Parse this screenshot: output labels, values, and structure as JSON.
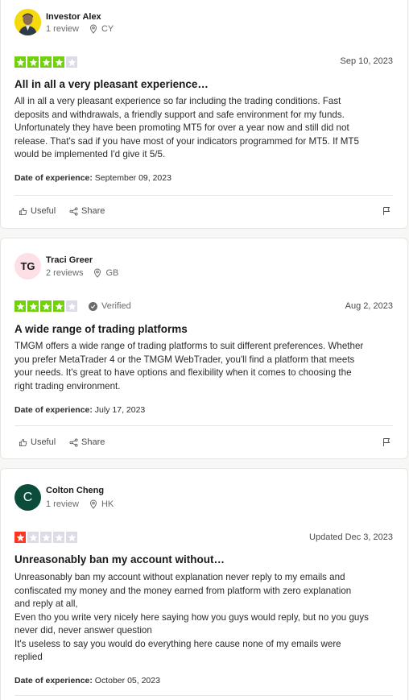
{
  "reviews": [
    {
      "name": "Investor Alex",
      "review_count": "1 review",
      "country": "CY",
      "rating": 4,
      "star_color": "#73cf11",
      "verified": "",
      "date": "Sep 10, 2023",
      "title": "All in all a very pleasant experience…",
      "body": [
        "All in all a very pleasant experience so far including the trading conditions. Fast",
        "deposits and withdrawals, a friendly support and safe environment for my funds.",
        "Unfortunately they have been promoting MT5 for over a year now and still did not",
        "release. That's sad if you have most of your indicators programmed for MT5. If MT5",
        "would be implemented I'd give it 5/5."
      ],
      "exp_label": "Date of experience:",
      "exp_date": "September 09, 2023",
      "useful": "Useful",
      "share": "Share"
    },
    {
      "name": "Traci Greer",
      "initials": "TG",
      "review_count": "2 reviews",
      "country": "GB",
      "rating": 4,
      "star_color": "#73cf11",
      "verified": "Verified",
      "date": "Aug 2, 2023",
      "title": "A wide range of trading platforms",
      "body": [
        "TMGM offers a wide range of trading platforms to suit different preferences. Whether",
        "you prefer MetaTrader 4 or the TMGM WebTrader, you'll find a platform that meets",
        "your needs. It's great to have options and flexibility when it comes to choosing the",
        "right trading environment."
      ],
      "exp_label": "Date of experience:",
      "exp_date": "July 17, 2023",
      "useful": "Useful",
      "share": "Share"
    },
    {
      "name": "Colton Cheng",
      "initials": "C",
      "review_count": "1 review",
      "country": "HK",
      "rating": 1,
      "star_color": "#ff3722",
      "verified": "",
      "date": "Updated Dec 3, 2023",
      "title": "Unreasonably ban my account without…",
      "body": [
        "Unreasonably ban my account without explanation never reply to my emails and",
        "confiscated my money and the money earned from platform with zero explanation",
        "and reply at all,",
        "Even tho you write very nicely here saying how you guys would reply, but no you guys",
        "never did, never answer question",
        "It's useless to say you would do everything here cause none of my emails were",
        "replied"
      ],
      "exp_label": "Date of experience:",
      "exp_date": "October 05, 2023"
    }
  ],
  "colors": {
    "empty_star": "#dcdce6",
    "tg_avatar_bg": "#fde0e6",
    "c_avatar_bg": "#0b4d3a",
    "alex_avatar_bg": "#f5d90a"
  }
}
